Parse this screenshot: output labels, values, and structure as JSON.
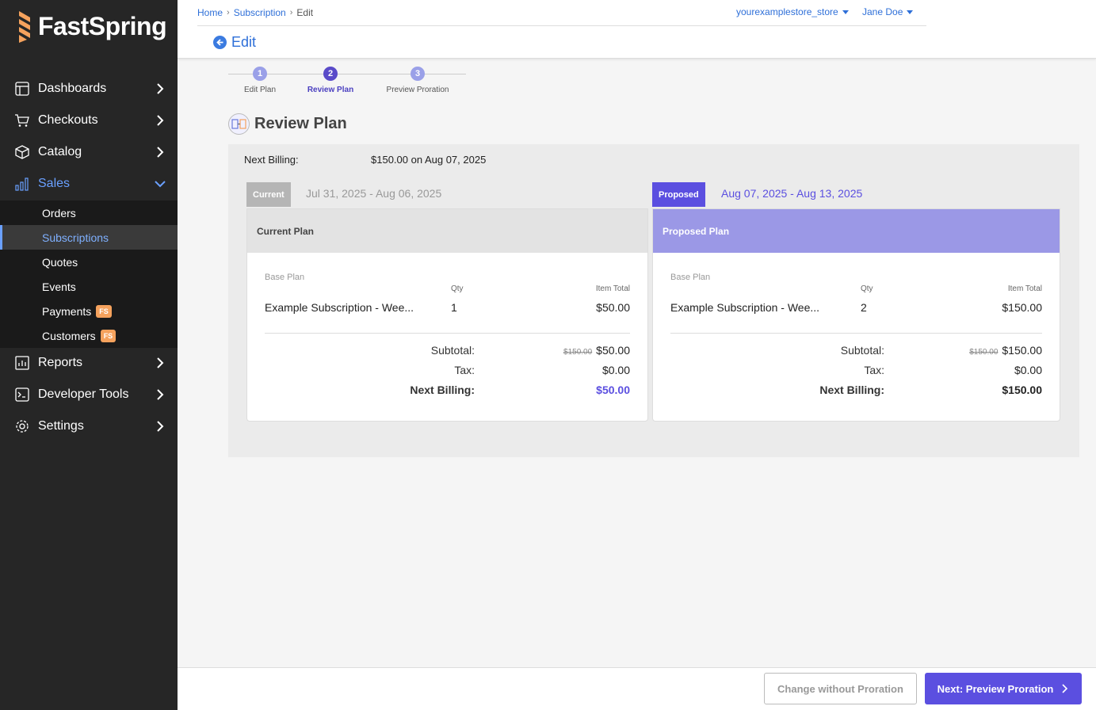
{
  "brand": {
    "name": "FastSpring",
    "logo_color": "#f5a25d"
  },
  "sidebar": {
    "items": [
      {
        "label": "Dashboards",
        "icon": "dashboard-icon"
      },
      {
        "label": "Checkouts",
        "icon": "cart-icon"
      },
      {
        "label": "Catalog",
        "icon": "box-icon"
      },
      {
        "label": "Sales",
        "icon": "chart-bars-icon",
        "active": true
      },
      {
        "label": "Reports",
        "icon": "report-icon"
      },
      {
        "label": "Developer Tools",
        "icon": "terminal-icon"
      },
      {
        "label": "Settings",
        "icon": "gear-icon"
      }
    ],
    "sales_sub": [
      {
        "label": "Orders"
      },
      {
        "label": "Subscriptions",
        "selected": true
      },
      {
        "label": "Quotes"
      },
      {
        "label": "Events"
      },
      {
        "label": "Payments",
        "badge": "FS"
      },
      {
        "label": "Customers",
        "badge": "FS"
      }
    ],
    "active_color": "#6aa0ff"
  },
  "header": {
    "breadcrumb": [
      "Home",
      "Subscription",
      "Edit"
    ],
    "store": "yourexamplestore_store",
    "user": "Jane Doe",
    "back_label": "Edit"
  },
  "stepper": {
    "steps": [
      {
        "num": "1",
        "label": "Edit Plan"
      },
      {
        "num": "2",
        "label": "Review Plan",
        "active": true
      },
      {
        "num": "3",
        "label": "Preview Proration"
      }
    ]
  },
  "page_title": "Review Plan",
  "next_billing": {
    "label": "Next Billing:",
    "value": "$150.00 on Aug 07, 2025"
  },
  "current": {
    "tag": "Current",
    "range": "Jul 31, 2025 - Aug 06, 2025",
    "card_title": "Current Plan",
    "base_plan": "Base Plan",
    "qty_header": "Qty",
    "total_header": "Item Total",
    "item_name": "Example Subscription - Wee...",
    "item_qty": "1",
    "item_total": "$50.00",
    "subtotal_label": "Subtotal:",
    "subtotal_strike": "$150.00",
    "subtotal": "$50.00",
    "tax_label": "Tax:",
    "tax": "$0.00",
    "next_billing_label": "Next Billing:",
    "next_billing": "$50.00"
  },
  "proposed": {
    "tag": "Proposed",
    "range": "Aug 07, 2025 - Aug 13, 2025",
    "card_title": "Proposed Plan",
    "base_plan": "Base Plan",
    "qty_header": "Qty",
    "total_header": "Item Total",
    "item_name": "Example Subscription - Wee...",
    "item_qty": "2",
    "item_total": "$150.00",
    "subtotal_label": "Subtotal:",
    "subtotal_strike": "$150.00",
    "subtotal": "$150.00",
    "tax_label": "Tax:",
    "tax": "$0.00",
    "next_billing_label": "Next Billing:",
    "next_billing": "$150.00"
  },
  "footer": {
    "secondary_label": "Change without Proration",
    "primary_label": "Next: Preview Proration"
  },
  "colors": {
    "accent": "#5b4fe0",
    "proposed_header": "#9b98e6",
    "link": "#2e6fd8"
  }
}
